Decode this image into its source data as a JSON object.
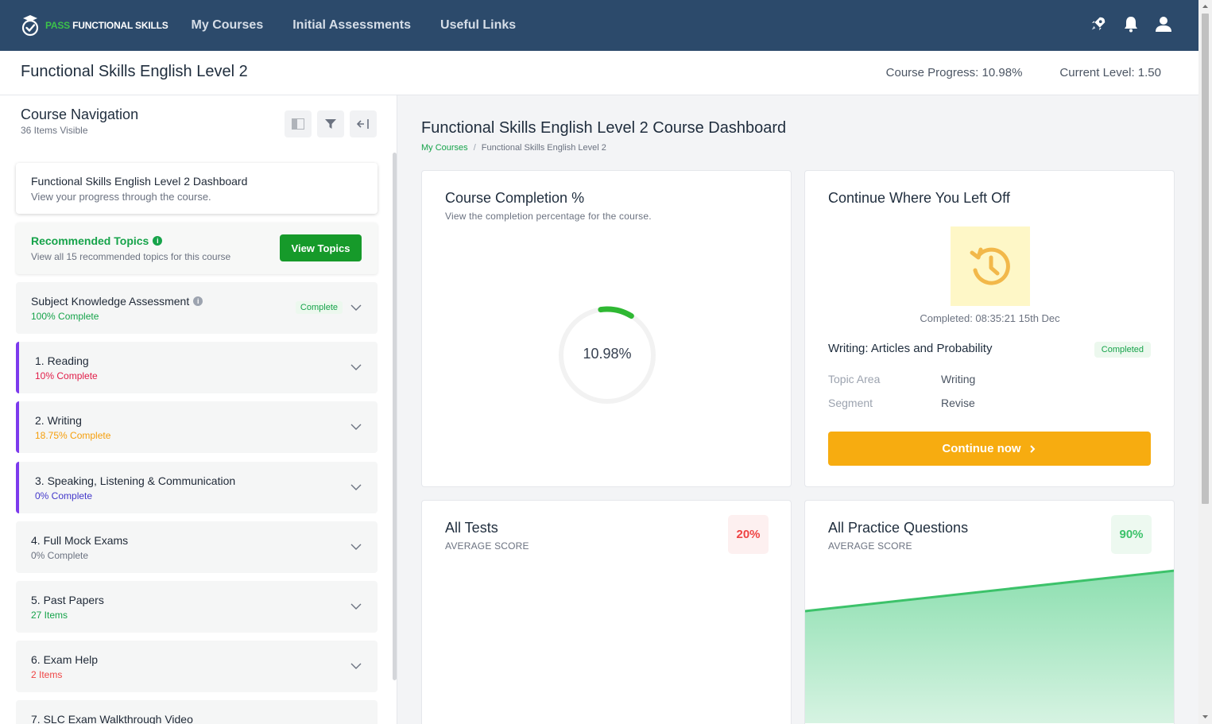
{
  "brand": {
    "pass": "PASS",
    "name": "FUNCTIONAL SKILLS"
  },
  "nav": [
    "My Courses",
    "Initial Assessments",
    "Useful Links"
  ],
  "icons": {
    "rocket": "rocket-icon",
    "bell": "bell-icon",
    "user": "user-icon"
  },
  "course": {
    "title": "Functional Skills English Level 2",
    "progress_label": "Course Progress:",
    "progress_value": "10.98%",
    "level_label": "Current Level:",
    "level_value": "1.50"
  },
  "sidebar": {
    "title": "Course Navigation",
    "subtitle": "36 Items Visible",
    "dashboard": {
      "title": "Functional Skills English Level 2 Dashboard",
      "subtitle": "View your progress through the course."
    },
    "recommended": {
      "title": "Recommended Topics",
      "subtitle": "View all 15 recommended topics for this course",
      "button": "View Topics"
    },
    "sections": [
      {
        "title": "Subject Knowledge Assessment",
        "status": "100% Complete",
        "status_color": "#16a34a",
        "badge": "Complete"
      },
      {
        "title": "1. Reading",
        "status": "10% Complete",
        "status_color": "#e11d48"
      },
      {
        "title": "2. Writing",
        "status": "18.75% Complete",
        "status_color": "#f59e0b"
      },
      {
        "title": "3. Speaking, Listening & Communication",
        "status": "0% Complete",
        "status_color": "#4338ca"
      },
      {
        "title": "4. Full Mock Exams",
        "status": "0% Complete",
        "status_color": "#6b7280"
      },
      {
        "title": "5. Past Papers",
        "status": "27 Items",
        "status_color": "#16a34a"
      },
      {
        "title": "6. Exam Help",
        "status": "2 Items",
        "status_color": "#ef4444"
      },
      {
        "title": "7. SLC Exam Walkthrough Video",
        "status": "",
        "status_color": "#6b7280"
      }
    ]
  },
  "main": {
    "title": "Functional Skills English Level 2 Course Dashboard",
    "breadcrumb": {
      "link": "My Courses",
      "separator": "/",
      "current": "Functional Skills English Level 2"
    },
    "completion": {
      "title": "Course Completion %",
      "subtitle": "View the completion percentage for the course.",
      "value_label": "10.98%",
      "fraction": 0.1098
    },
    "continue": {
      "title": "Continue Where You Left Off",
      "completed_at": "Completed: 08:35:21 15th Dec",
      "topic": "Writing: Articles and Probability",
      "badge": "Completed",
      "rows": [
        {
          "key": "Topic Area",
          "value": "Writing"
        },
        {
          "key": "Segment",
          "value": "Revise"
        }
      ],
      "button": "Continue now"
    },
    "tests": {
      "title": "All Tests",
      "subtitle": "AVERAGE SCORE",
      "score": "20%"
    },
    "practice": {
      "title": "All Practice Questions",
      "subtitle": "AVERAGE SCORE",
      "score": "90%"
    }
  },
  "colors": {
    "nav_bg": "#2c4a6b",
    "green": "#169a2a",
    "orange": "#f7ac10",
    "accent_bar": "#7c3aed"
  }
}
